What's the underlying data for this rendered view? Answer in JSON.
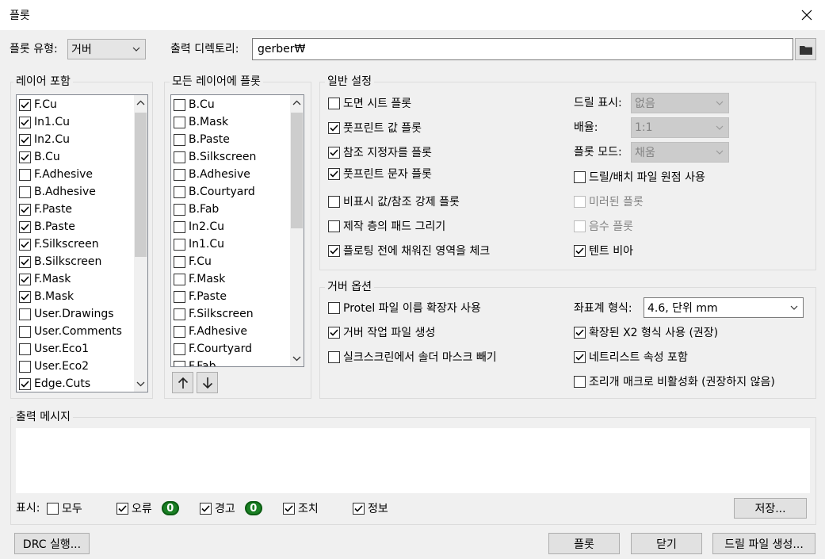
{
  "window": {
    "title": "플롯"
  },
  "top": {
    "plot_type_label": "플롯 유형:",
    "plot_type_value": "거버",
    "output_dir_label": "출력 디렉토리:",
    "output_dir_value": "gerber₩"
  },
  "include_layers": {
    "title": "레이어 포함",
    "items": [
      {
        "label": "F.Cu",
        "checked": true
      },
      {
        "label": "In1.Cu",
        "checked": true
      },
      {
        "label": "In2.Cu",
        "checked": true
      },
      {
        "label": "B.Cu",
        "checked": true
      },
      {
        "label": "F.Adhesive",
        "checked": false
      },
      {
        "label": "B.Adhesive",
        "checked": false
      },
      {
        "label": "F.Paste",
        "checked": true
      },
      {
        "label": "B.Paste",
        "checked": true
      },
      {
        "label": "F.Silkscreen",
        "checked": true
      },
      {
        "label": "B.Silkscreen",
        "checked": true
      },
      {
        "label": "F.Mask",
        "checked": true
      },
      {
        "label": "B.Mask",
        "checked": true
      },
      {
        "label": "User.Drawings",
        "checked": false
      },
      {
        "label": "User.Comments",
        "checked": false
      },
      {
        "label": "User.Eco1",
        "checked": false
      },
      {
        "label": "User.Eco2",
        "checked": false
      },
      {
        "label": "Edge.Cuts",
        "checked": true
      }
    ]
  },
  "all_layers": {
    "title": "모든 레이어에 플롯",
    "items": [
      {
        "label": "B.Cu",
        "checked": false
      },
      {
        "label": "B.Mask",
        "checked": false
      },
      {
        "label": "B.Paste",
        "checked": false
      },
      {
        "label": "B.Silkscreen",
        "checked": false
      },
      {
        "label": "B.Adhesive",
        "checked": false
      },
      {
        "label": "B.Courtyard",
        "checked": false
      },
      {
        "label": "B.Fab",
        "checked": false
      },
      {
        "label": "In2.Cu",
        "checked": false
      },
      {
        "label": "In1.Cu",
        "checked": false
      },
      {
        "label": "F.Cu",
        "checked": false
      },
      {
        "label": "F.Mask",
        "checked": false
      },
      {
        "label": "F.Paste",
        "checked": false
      },
      {
        "label": "F.Silkscreen",
        "checked": false
      },
      {
        "label": "F.Adhesive",
        "checked": false
      },
      {
        "label": "F.Courtyard",
        "checked": false
      },
      {
        "label": "F.Fab",
        "checked": false
      }
    ]
  },
  "general": {
    "title": "일반 설정",
    "left": [
      {
        "label": "도면 시트 플롯",
        "checked": false,
        "disabled": false
      },
      {
        "label": "풋프린트 값 플롯",
        "checked": true,
        "disabled": false
      },
      {
        "label": "참조 지정자를 플롯",
        "checked": true,
        "disabled": false
      },
      {
        "label": "풋프린트 문자 플롯",
        "checked": true,
        "disabled": false
      },
      {
        "label": "비표시 값/참조 강제 플롯",
        "checked": false,
        "disabled": false
      },
      {
        "label": "제작 층의 패드 그리기",
        "checked": false,
        "disabled": false
      },
      {
        "label": "플로팅 전에 채워진 영역을 체크",
        "checked": true,
        "disabled": false
      }
    ],
    "drill_marks_label": "드릴 표시:",
    "drill_marks_value": "없음",
    "scale_label": "배율:",
    "scale_value": "1:1",
    "plot_mode_label": "플롯 모드:",
    "plot_mode_value": "채움",
    "right": [
      {
        "label": "드릴/배치 파일 원점 사용",
        "checked": false,
        "disabled": false
      },
      {
        "label": "미러된 플롯",
        "checked": false,
        "disabled": true
      },
      {
        "label": "음수 플롯",
        "checked": false,
        "disabled": true
      },
      {
        "label": "텐트 비아",
        "checked": true,
        "disabled": false
      }
    ]
  },
  "gerber": {
    "title": "거버 옵션",
    "left": [
      {
        "label": "Protel 파일 이름 확장자 사용",
        "checked": false
      },
      {
        "label": "거버 작업 파일 생성",
        "checked": true
      },
      {
        "label": "실크스크린에서 솔더 마스크 빼기",
        "checked": false
      }
    ],
    "coord_label": "좌표계 형식:",
    "coord_value": "4.6, 단위 mm",
    "right": [
      {
        "label": "확장된 X2 형식 사용 (권장)",
        "checked": true
      },
      {
        "label": "네트리스트 속성 포함",
        "checked": true
      },
      {
        "label": "조리개 매크로 비활성화 (권장하지 않음)",
        "checked": false
      }
    ]
  },
  "messages": {
    "title": "출력 메시지",
    "show_label": "표시:",
    "filter_all": "모두",
    "filter_errors": "오류",
    "errors_count": "0",
    "filter_warnings": "경고",
    "warnings_count": "0",
    "filter_actions": "조치",
    "filter_infos": "정보",
    "save_label": "저장..."
  },
  "buttons": {
    "drc": "DRC 실행...",
    "plot": "플롯",
    "close": "닫기",
    "drill": "드릴 파일 생성..."
  },
  "colors": {
    "badge_green": "#1a7f24",
    "accent": "#0078d7"
  }
}
